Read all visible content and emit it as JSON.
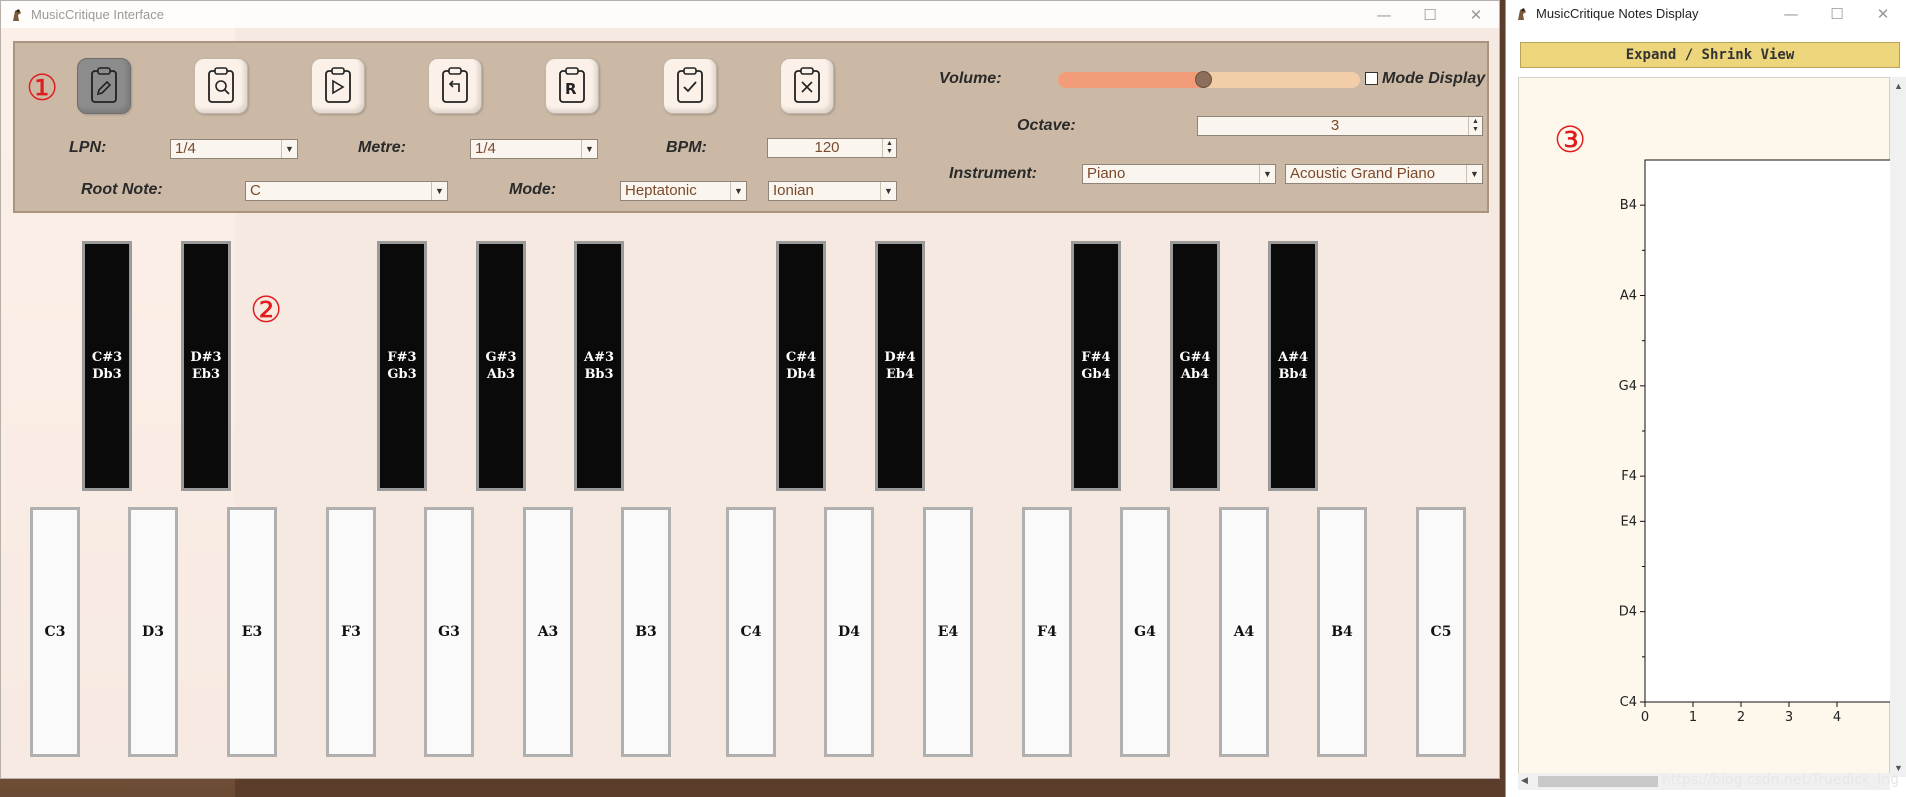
{
  "main_window": {
    "title": "MusicCritique Interface",
    "controls": [
      "—",
      "☐",
      "✕"
    ]
  },
  "annotations": [
    "①",
    "②",
    "③"
  ],
  "toolbar": [
    {
      "name": "edit-notes-button",
      "icon": "clipboard-pen-icon",
      "active": true
    },
    {
      "name": "search-notes-button",
      "icon": "clipboard-search-icon"
    },
    {
      "name": "play-button",
      "icon": "clipboard-play-icon"
    },
    {
      "name": "undo-button",
      "icon": "clipboard-back-icon"
    },
    {
      "name": "reset-button",
      "icon": "clipboard-r-icon"
    },
    {
      "name": "check-button",
      "icon": "clipboard-check-icon"
    },
    {
      "name": "clear-button",
      "icon": "clipboard-x-icon"
    }
  ],
  "settings": {
    "lpn_label": "LPN:",
    "lpn_value": "1/4",
    "metre_label": "Metre:",
    "metre_value": "1/4",
    "bpm_label": "BPM:",
    "bpm_value": "120",
    "root_label": "Root Note:",
    "root_value": "C",
    "mode_label": "Mode:",
    "mode_type": "Heptatonic",
    "mode_value": "Ionian",
    "volume_label": "Volume:",
    "volume_level": 0.48,
    "mode_display_label": "Mode Display",
    "mode_display_checked": false,
    "octave_label": "Octave:",
    "octave_value": "3",
    "instrument_label": "Instrument:",
    "instrument_family": "Piano",
    "instrument_value": "Acoustic Grand Piano"
  },
  "black_keys": [
    {
      "sharp": "C#3",
      "flat": "Db3"
    },
    {
      "sharp": "D#3",
      "flat": "Eb3"
    },
    {
      "sharp": "F#3",
      "flat": "Gb3"
    },
    {
      "sharp": "G#3",
      "flat": "Ab3"
    },
    {
      "sharp": "A#3",
      "flat": "Bb3"
    },
    {
      "sharp": "C#4",
      "flat": "Db4"
    },
    {
      "sharp": "D#4",
      "flat": "Eb4"
    },
    {
      "sharp": "F#4",
      "flat": "Gb4"
    },
    {
      "sharp": "G#4",
      "flat": "Ab4"
    },
    {
      "sharp": "A#4",
      "flat": "Bb4"
    }
  ],
  "white_keys": [
    "C3",
    "D3",
    "E3",
    "F3",
    "G3",
    "A3",
    "B3",
    "C4",
    "D4",
    "E4",
    "F4",
    "G4",
    "A4",
    "B4",
    "C5"
  ],
  "notes_window": {
    "title": "MusicCritique Notes Display",
    "controls": [
      "—",
      "☐",
      "✕"
    ],
    "expand_label": "Expand / Shrink View",
    "watermark": "https://blog.csdn.net/Truedick_Ing"
  },
  "chart_data": {
    "type": "scatter",
    "y_tick_labels": [
      "B4",
      "A4",
      "G4",
      "F4",
      "E4",
      "D4",
      "C4"
    ],
    "x_tick_labels": [
      "0",
      "1",
      "2",
      "3",
      "4"
    ],
    "series": []
  }
}
